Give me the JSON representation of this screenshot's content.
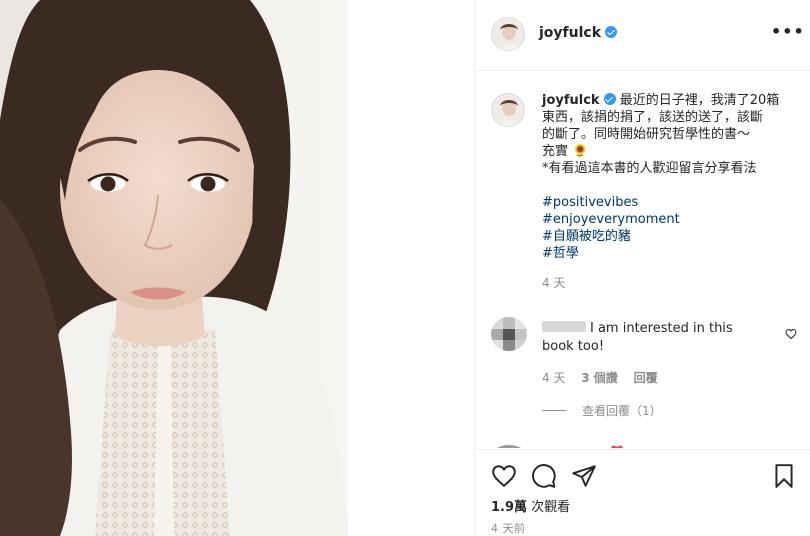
{
  "post": {
    "username": "joyfulck",
    "more_icon": "•••"
  },
  "caption": {
    "username": "joyfulck",
    "lines": [
      "最近的日子裡，我清了20箱",
      "東西，該捐的捐了，該送的送了，該斷",
      "的斷了。同時開始研究哲學性的書～",
      "充實 🌻",
      "*有看過這本書的人歡迎留言分享看法"
    ],
    "hashtags": [
      "#positivevibes",
      "#enjoyeverymoment",
      "#自願被吃的豬",
      "#哲學"
    ],
    "time": "4 天"
  },
  "comment": {
    "text_line1": "I am interested in this",
    "text_line2": "book too!",
    "time": "4 天",
    "likes": "3 個讚",
    "reply_label": "回覆",
    "view_replies": "查看回覆（1）"
  },
  "actions": {
    "views_count": "1.9萬",
    "views_label": "次觀看",
    "post_time": "4 天前"
  },
  "colors": {
    "verified": "#3897f0",
    "hashtag": "#00376b",
    "muted": "#8e8e8e",
    "heart_red": "#ed4956"
  },
  "icons": [
    "verified-badge-icon",
    "more-options-icon",
    "heart-icon",
    "comment-icon",
    "share-icon",
    "bookmark-icon"
  ]
}
